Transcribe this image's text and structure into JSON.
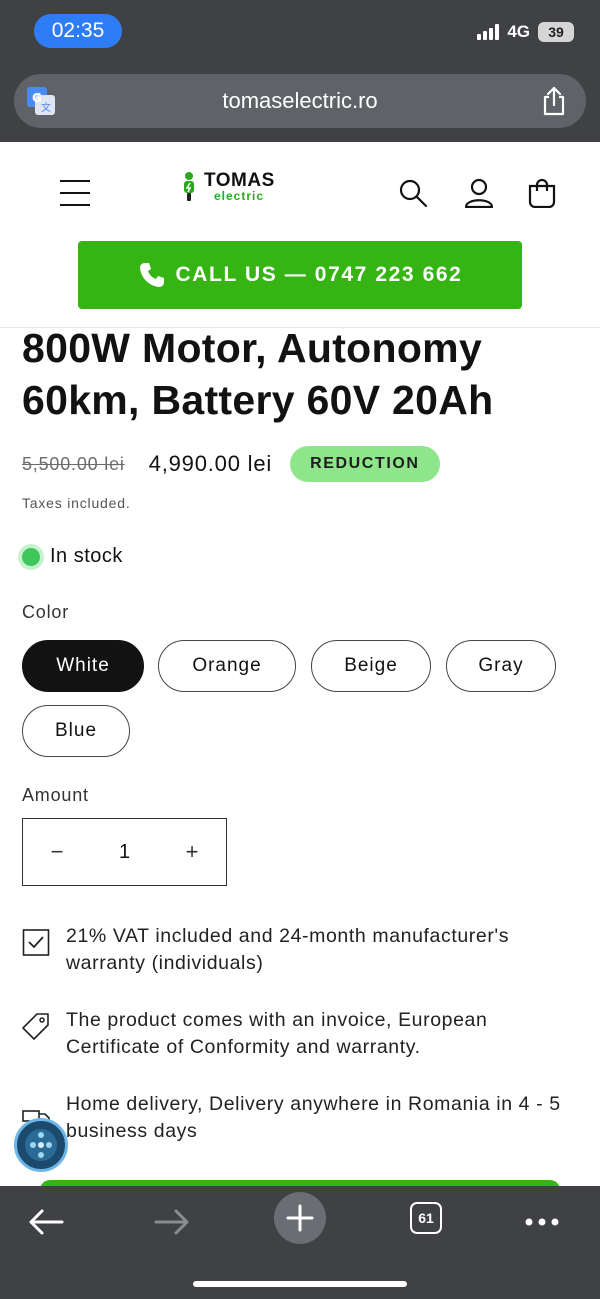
{
  "status_bar": {
    "time": "02:35",
    "network": "4G",
    "battery": "39"
  },
  "browser": {
    "url": "tomaselectric.ro",
    "tabs_count": "61"
  },
  "header": {
    "logo_main": "TOMAS",
    "logo_sub": "electric",
    "call_label": "CALL US —  0747 223 662"
  },
  "product": {
    "title": "800W Motor, Autonomy 60km, Battery 60V 20Ah",
    "old_price": "5,500.00 lei",
    "new_price": "4,990.00 lei",
    "badge": "REDUCTION",
    "taxes": "Taxes included.",
    "stock": "In stock",
    "color_label": "Color",
    "colors": [
      "White",
      "Orange",
      "Beige",
      "Gray",
      "Blue"
    ],
    "selected_color": "White",
    "amount_label": "Amount",
    "quantity": "1",
    "qty_minus": "−",
    "qty_plus": "+"
  },
  "features": [
    {
      "icon": "checkbox-icon",
      "text": "21% VAT included and 24-month manufacturer's warranty (individuals)"
    },
    {
      "icon": "tag-icon",
      "text": "The product comes with an invoice, European Certificate of Conformity and warranty."
    },
    {
      "icon": "truck-icon",
      "text": "Home delivery, Delivery anywhere in Romania in 4 - 5 business days"
    }
  ],
  "colors": {
    "brand_green": "#35b414",
    "badge_green": "#8fe58a",
    "stock_dot": "#3ec85b",
    "chrome": "#3f4144"
  }
}
